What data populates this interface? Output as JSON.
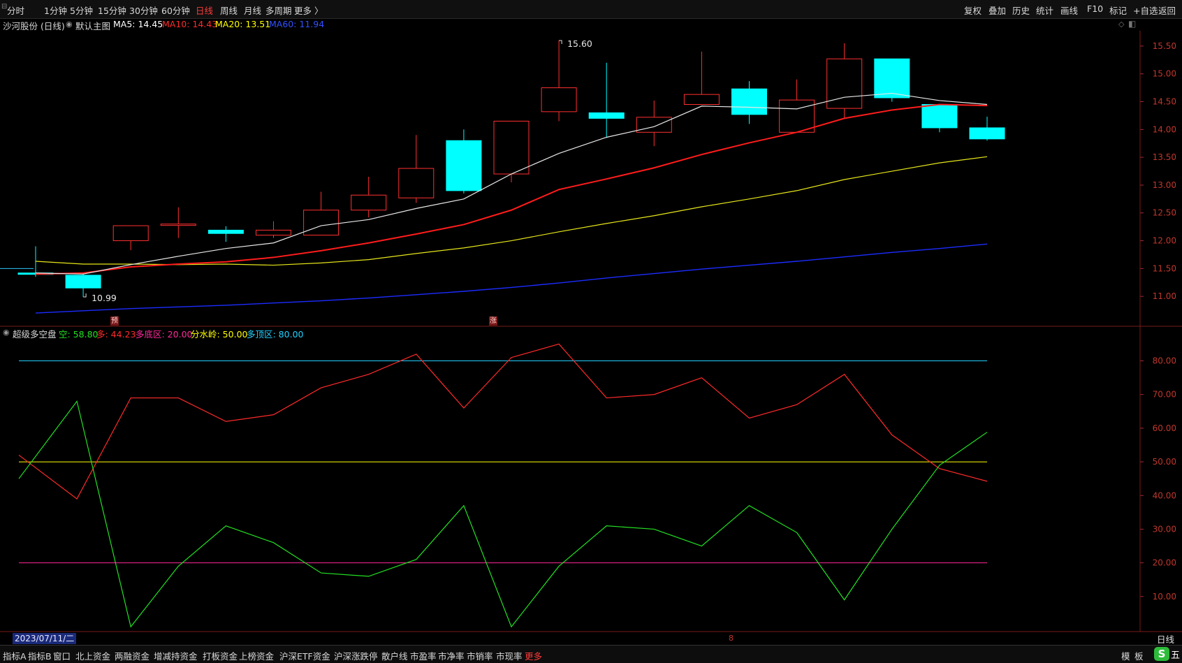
{
  "toolbar": {
    "periods": [
      "分时",
      "1分钟",
      "5分钟",
      "15分钟",
      "30分钟",
      "60分钟",
      "日线",
      "周线",
      "月线",
      "多周期",
      "更多 〉"
    ],
    "active_period": "日线",
    "right_items": [
      "复权",
      "叠加",
      "历史",
      "统计",
      "画线",
      "F10",
      "标记",
      "+自选",
      "返回"
    ]
  },
  "main_chart": {
    "stock_title": "沙河股份 (日线)",
    "template_label": "默认主图",
    "ma": [
      {
        "label": "MA5: 14.45",
        "color": "#ffffff"
      },
      {
        "label": "MA10: 14.43",
        "color": "#ff2a2a"
      },
      {
        "label": "MA20: 13.51",
        "color": "#ffff00"
      },
      {
        "label": "MA60: 11.94",
        "color": "#3050ff"
      }
    ],
    "high_note": "15.60",
    "low_note": "10.99",
    "marker_yu": "预",
    "marker_zhang": "涨"
  },
  "indicator": {
    "name": "超级多空盘",
    "values": [
      {
        "label": "空: 58.80",
        "color": "#22e022"
      },
      {
        "label": "多: 44.23",
        "color": "#ff2a2a"
      },
      {
        "label": "多底区: 20.00",
        "color": "#ff2a9a"
      },
      {
        "label": "分水岭: 50.00",
        "color": "#ffff00"
      },
      {
        "label": "多顶区: 80.00",
        "color": "#22d0ff"
      }
    ]
  },
  "date_label": "2023/07/11/二",
  "period_label": "日线",
  "scrollbar_marker": "8",
  "bottom_tabs": [
    "指标A",
    "指标B",
    "窗口",
    "北上资金",
    "两融资金",
    "增减持资金",
    "打板资金",
    "上榜资金",
    "沪深ETF资金",
    "沪深涨跌停",
    "散户线",
    "市盈率",
    "市净率",
    "市销率",
    "市现率",
    "更多"
  ],
  "bottom_right": [
    "模",
    "板"
  ],
  "colors": {
    "up": "#ff3030",
    "down": "#00ffff",
    "ma5": "#e8e8e8",
    "ma10": "#ff1c1c",
    "ma20": "#e6e61a",
    "ma60": "#1c2cff"
  },
  "chart_data": [
    {
      "type": "candlestick",
      "title": "沙河股份 (日线)",
      "ylim": [
        10.6,
        15.7
      ],
      "yticks": [
        11.0,
        11.5,
        12.0,
        12.5,
        13.0,
        13.5,
        14.0,
        14.5,
        15.0,
        15.5
      ],
      "candles": [
        {
          "o": 11.42,
          "c": 11.4,
          "h": 11.9,
          "l": 11.35
        },
        {
          "o": 11.38,
          "c": 11.15,
          "h": 11.42,
          "l": 10.99
        },
        {
          "o": 12.0,
          "c": 12.27,
          "h": 12.27,
          "l": 11.83
        },
        {
          "o": 12.28,
          "c": 12.3,
          "h": 12.6,
          "l": 12.05
        },
        {
          "o": 12.19,
          "c": 12.13,
          "h": 12.26,
          "l": 11.98
        },
        {
          "o": 12.1,
          "c": 12.19,
          "h": 12.35,
          "l": 12.05
        },
        {
          "o": 12.1,
          "c": 12.55,
          "h": 12.88,
          "l": 12.1
        },
        {
          "o": 12.55,
          "c": 12.82,
          "h": 13.15,
          "l": 12.42
        },
        {
          "o": 12.77,
          "c": 13.3,
          "h": 13.9,
          "l": 12.68
        },
        {
          "o": 13.8,
          "c": 12.9,
          "h": 14.0,
          "l": 12.85
        },
        {
          "o": 13.2,
          "c": 14.15,
          "h": 14.15,
          "l": 13.05
        },
        {
          "o": 14.32,
          "c": 14.75,
          "h": 15.6,
          "l": 14.15
        },
        {
          "o": 14.3,
          "c": 14.2,
          "h": 15.2,
          "l": 13.85
        },
        {
          "o": 13.95,
          "c": 14.22,
          "h": 14.52,
          "l": 13.7
        },
        {
          "o": 14.45,
          "c": 14.63,
          "h": 15.4,
          "l": 14.45
        },
        {
          "o": 14.73,
          "c": 14.27,
          "h": 14.87,
          "l": 14.1
        },
        {
          "o": 13.95,
          "c": 14.53,
          "h": 14.9,
          "l": 13.95
        },
        {
          "o": 14.38,
          "c": 15.27,
          "h": 15.55,
          "l": 14.2
        },
        {
          "o": 15.27,
          "c": 14.57,
          "h": 15.27,
          "l": 14.5
        },
        {
          "o": 14.45,
          "c": 14.03,
          "h": 14.45,
          "l": 13.95
        },
        {
          "o": 14.03,
          "c": 13.83,
          "h": 14.23,
          "l": 13.8
        }
      ],
      "ma5": [
        11.42,
        11.4,
        11.57,
        11.72,
        11.86,
        11.96,
        12.27,
        12.38,
        12.58,
        12.75,
        13.2,
        13.57,
        13.86,
        14.05,
        14.42,
        14.4,
        14.37,
        14.58,
        14.65,
        14.52,
        14.45
      ],
      "ma10": [
        11.4,
        11.42,
        11.53,
        11.58,
        11.62,
        11.7,
        11.82,
        11.96,
        12.12,
        12.29,
        12.55,
        12.92,
        13.11,
        13.31,
        13.55,
        13.76,
        13.95,
        14.2,
        14.35,
        14.45,
        14.43
      ],
      "ma20": [
        11.63,
        11.58,
        11.58,
        11.57,
        11.58,
        11.56,
        11.6,
        11.66,
        11.77,
        11.87,
        12.0,
        12.16,
        12.31,
        12.45,
        12.61,
        12.75,
        12.9,
        13.1,
        13.25,
        13.4,
        13.51
      ],
      "ma60": [
        10.7,
        10.74,
        10.78,
        10.81,
        10.84,
        10.88,
        10.92,
        10.97,
        11.03,
        11.09,
        11.16,
        11.24,
        11.33,
        11.41,
        11.49,
        11.56,
        11.63,
        11.71,
        11.79,
        11.86,
        11.94
      ]
    },
    {
      "type": "line",
      "title": "超级多空盘",
      "ylim": [
        0,
        88
      ],
      "yticks": [
        10,
        20,
        30,
        40,
        50,
        60,
        70,
        80
      ],
      "series": [
        {
          "name": "空",
          "color": "#22e022",
          "values": [
            45,
            68,
            1,
            19,
            31,
            26,
            17,
            16,
            21,
            37,
            1,
            19,
            31,
            30,
            25,
            37,
            29,
            9,
            30,
            49,
            58.8
          ]
        },
        {
          "name": "多",
          "color": "#ff2a2a",
          "values": [
            52,
            39,
            69,
            69,
            62,
            64,
            72,
            76,
            82,
            66,
            81,
            85,
            69,
            70,
            75,
            63,
            67,
            76,
            58,
            48,
            44.23
          ]
        },
        {
          "name": "多底区",
          "color": "#ff2a9a",
          "values": [
            20,
            20
          ]
        },
        {
          "name": "分水岭",
          "color": "#ffff00",
          "values": [
            50,
            50
          ]
        },
        {
          "name": "多顶区",
          "color": "#22d0ff",
          "values": [
            80,
            80
          ]
        }
      ]
    }
  ]
}
